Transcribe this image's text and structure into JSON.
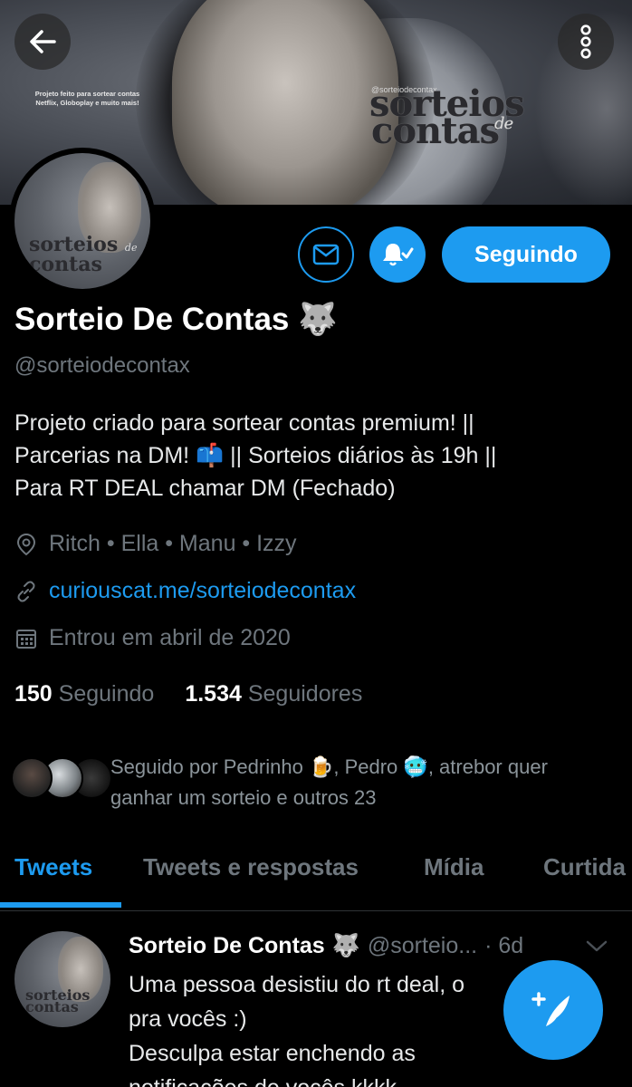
{
  "banner": {
    "caption_line1": "Projeto feito para  sortear contas",
    "caption_line2": "Netflix, Globoplay e muito mais!",
    "handle": "@sorteiodecontax",
    "brand_line1": "sorteios",
    "brand_de": "de",
    "brand_line2": "contas"
  },
  "top_bar": {
    "back_icon": "arrow-left-icon",
    "more_icon": "more-vertical-icon"
  },
  "avatar": {
    "line1": "sorteios",
    "de": "de",
    "line2": "contas"
  },
  "actions": {
    "message_icon": "envelope-icon",
    "notifications_icon": "bell-check-icon",
    "follow_label": "Seguindo"
  },
  "profile": {
    "name": "Sorteio De Contas",
    "name_emoji": "🐺",
    "handle": "@sorteiodecontax",
    "bio_line1": "Projeto criado para sortear contas premium! ||",
    "bio_line2_a": "Parcerias na DM!",
    "bio_emoji": "📫",
    "bio_line2_b": "|| Sorteios diários às 19h ||",
    "bio_line3": "Para RT DEAL chamar DM (Fechado)",
    "location": "Ritch • Ella • Manu • Izzy",
    "website": "curiouscat.me/sorteiodecontax",
    "joined": "Entrou em abril de 2020"
  },
  "stats": {
    "following_count": "150",
    "following_label": "Seguindo",
    "followers_count": "1.534",
    "followers_label": "Seguidores"
  },
  "followed_by": {
    "prefix": "Seguido por Pedrinho",
    "emoji1": "🍺",
    "mid": ", Pedro",
    "emoji2": "🥶",
    "suffix": ", atrebor quer",
    "line2": "ganhar um sorteio e outros 23"
  },
  "tabs": [
    {
      "label": "Tweets",
      "active": true
    },
    {
      "label": "Tweets e respostas",
      "active": false
    },
    {
      "label": "Mídia",
      "active": false
    },
    {
      "label": "Curtida",
      "active": false
    }
  ],
  "tweet": {
    "author": "Sorteio De Contas",
    "author_emoji": "🐺",
    "handle": "@sorteio...",
    "time": "· 6d",
    "line1": "Uma pessoa desistiu do rt deal, o",
    "line2": "pra vocês :)",
    "line3": "Desculpa estar enchendo as",
    "line4": "notificações de vocês kkkk"
  },
  "colors": {
    "accent": "#1d9bf0",
    "background": "#000000",
    "muted": "#6e767d"
  }
}
